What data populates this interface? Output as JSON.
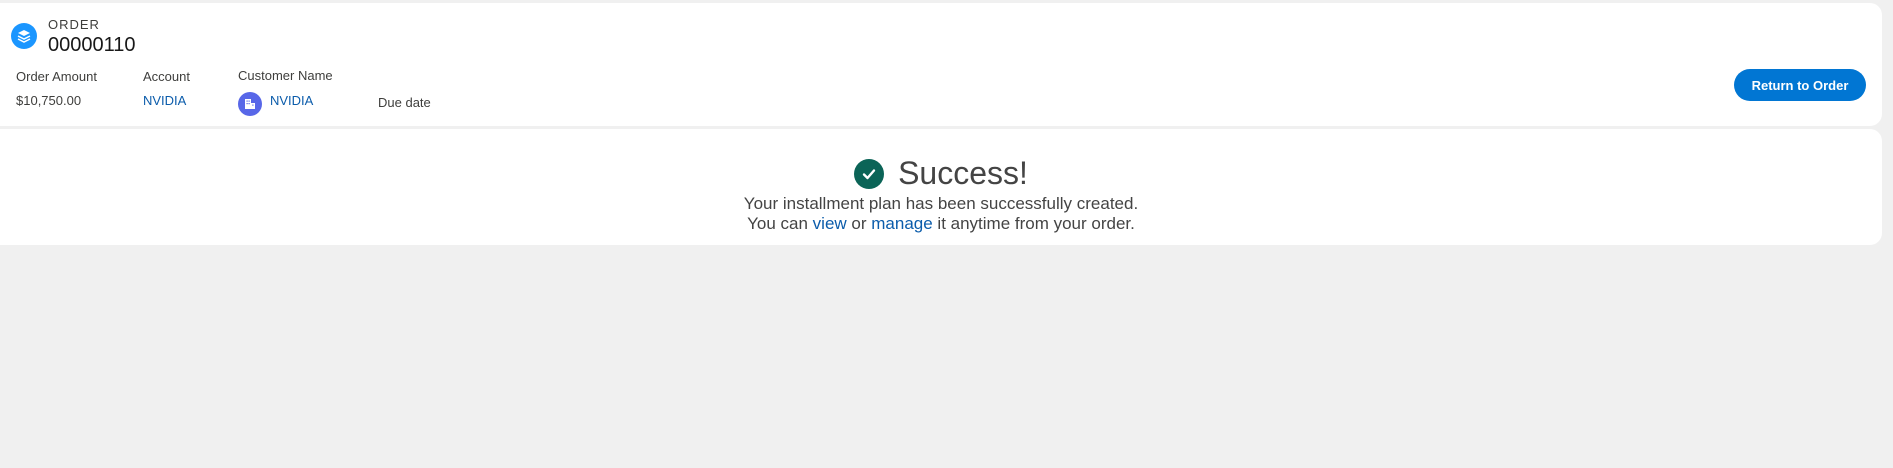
{
  "header": {
    "order_label": "ORDER",
    "order_number": "00000110",
    "icon": "stack-layers-icon",
    "fields": {
      "order_amount": {
        "label": "Order Amount",
        "value": "$10,750.00"
      },
      "account": {
        "label": "Account",
        "value": "NVIDIA"
      },
      "customer_name": {
        "label": "Customer Name",
        "value": "NVIDIA",
        "avatar_icon": "building-icon"
      },
      "due_date": {
        "label": "Due date"
      }
    },
    "return_button": "Return to Order"
  },
  "success": {
    "icon": "check-circle-icon",
    "title": "Success!",
    "line1": "Your installment plan has been successfully created.",
    "line2_prefix": "You can ",
    "view_link": "view",
    "line2_mid": " or ",
    "manage_link": "manage",
    "line2_suffix": " it anytime from your order."
  },
  "colors": {
    "brand_blue": "#0176d3",
    "link": "#0b5cab",
    "success_green": "#0b6457",
    "order_icon_bg": "#1b96ff",
    "avatar_bg": "#5867e8"
  }
}
